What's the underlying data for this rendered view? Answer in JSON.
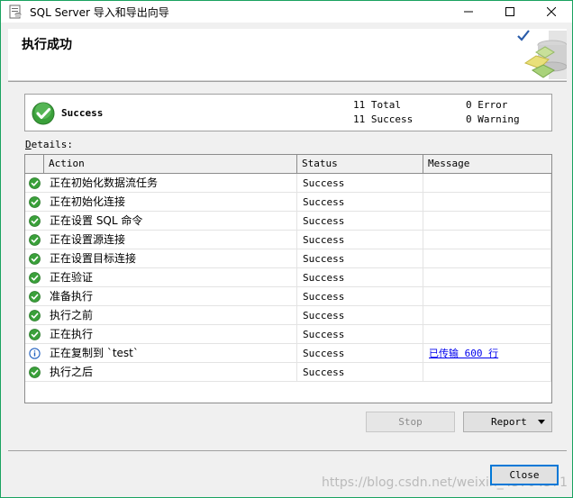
{
  "window": {
    "title": "SQL Server 导入和导出向导"
  },
  "header": {
    "heading": "执行成功"
  },
  "summary": {
    "status": "Success",
    "total_line": "11 Total",
    "success_line": "11 Success",
    "error_line": "0 Error",
    "warning_line": "0 Warning"
  },
  "details": {
    "label_prefix": "D",
    "label_rest": "etails:"
  },
  "grid": {
    "columns": [
      "Action",
      "Status",
      "Message"
    ],
    "rows": [
      {
        "icon": "success-check-icon",
        "action": "正在初始化数据流任务",
        "status": "Success",
        "message": ""
      },
      {
        "icon": "success-check-icon",
        "action": "正在初始化连接",
        "status": "Success",
        "message": ""
      },
      {
        "icon": "success-check-icon",
        "action": "正在设置 SQL 命令",
        "status": "Success",
        "message": ""
      },
      {
        "icon": "success-check-icon",
        "action": "正在设置源连接",
        "status": "Success",
        "message": ""
      },
      {
        "icon": "success-check-icon",
        "action": "正在设置目标连接",
        "status": "Success",
        "message": ""
      },
      {
        "icon": "success-check-icon",
        "action": "正在验证",
        "status": "Success",
        "message": ""
      },
      {
        "icon": "success-check-icon",
        "action": "准备执行",
        "status": "Success",
        "message": ""
      },
      {
        "icon": "success-check-icon",
        "action": "执行之前",
        "status": "Success",
        "message": ""
      },
      {
        "icon": "success-check-icon",
        "action": "正在执行",
        "status": "Success",
        "message": ""
      },
      {
        "icon": "info-icon",
        "action": "正在复制到 `test`",
        "status": "Success",
        "message": "已传输 600 行"
      },
      {
        "icon": "success-check-icon",
        "action": "执行之后",
        "status": "Success",
        "message": ""
      }
    ]
  },
  "buttons": {
    "stop": "Stop",
    "report": "Report",
    "close": "Close"
  },
  "watermark": "https://blog.csdn.net/weixin_43704571",
  "colors": {
    "success_green": "#3aa03a",
    "info_blue": "#1f5fbf",
    "link_blue": "#0000ee",
    "window_border": "#1aa260",
    "focus_border": "#0078d7"
  }
}
